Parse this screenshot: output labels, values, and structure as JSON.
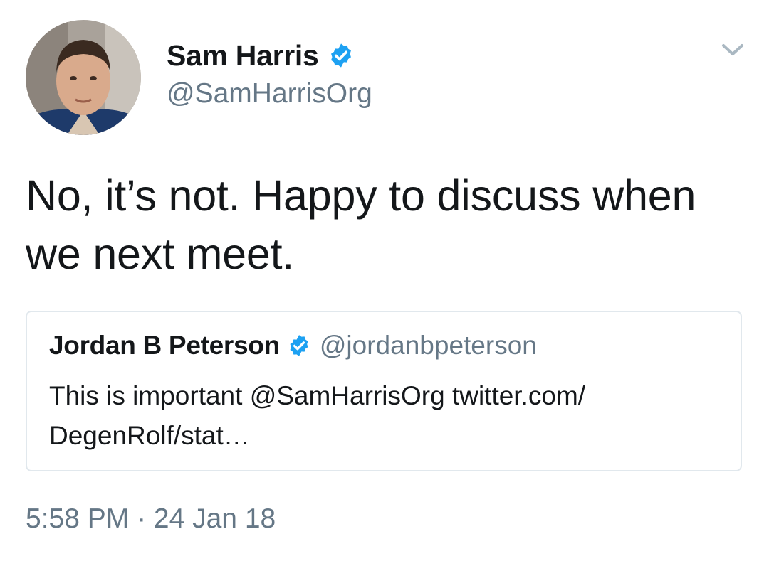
{
  "tweet": {
    "author": {
      "display_name": "Sam Harris",
      "handle": "@SamHarrisOrg",
      "verified": true
    },
    "text": "No, it’s not. Happy to discuss when we next meet.",
    "quoted_tweet": {
      "display_name": "Jordan B Peterson",
      "handle": "@jordanbpeterson",
      "verified": true,
      "text": "This is important @SamHarrisOrg twitter.com/ DegenRolf/stat…"
    },
    "timestamp": "5:58 PM · 24 Jan 18"
  },
  "icons": {
    "verified": "verified-badge-icon",
    "menu": "chevron-down-icon"
  },
  "colors": {
    "text_primary": "#14171a",
    "text_secondary": "#657786",
    "verified_blue": "#1da1f2",
    "card_border": "#e1e8ed"
  }
}
